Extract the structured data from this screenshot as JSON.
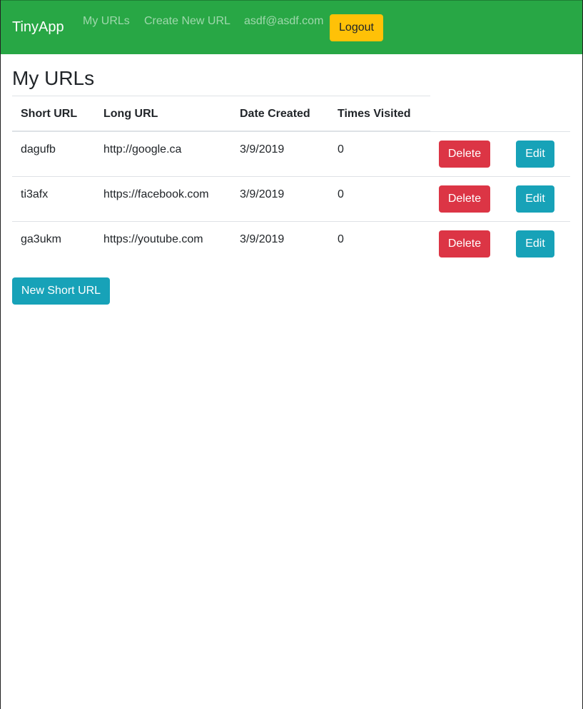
{
  "navbar": {
    "brand": "TinyApp",
    "links": {
      "my_urls": "My URLs",
      "create_new": "Create New URL",
      "email": "asdf@asdf.com"
    },
    "logout_label": "Logout"
  },
  "main": {
    "title": "My URLs",
    "table": {
      "headers": [
        "Short URL",
        "Long URL",
        "Date Created",
        "Times Visited"
      ],
      "rows": [
        {
          "short_url": "dagufb",
          "long_url": "http://google.ca",
          "date_created": "3/9/2019",
          "times_visited": "0",
          "delete_label": "Delete",
          "edit_label": "Edit"
        },
        {
          "short_url": "ti3afx",
          "long_url": "https://facebook.com",
          "date_created": "3/9/2019",
          "times_visited": "0",
          "delete_label": "Delete",
          "edit_label": "Edit"
        },
        {
          "short_url": "ga3ukm",
          "long_url": "https://youtube.com",
          "date_created": "3/9/2019",
          "times_visited": "0",
          "delete_label": "Delete",
          "edit_label": "Edit"
        }
      ]
    },
    "new_button_label": "New Short URL"
  },
  "colors": {
    "navbar": "#28a745",
    "logout": "#ffc107",
    "delete": "#dc3545",
    "info": "#17a2b8"
  }
}
